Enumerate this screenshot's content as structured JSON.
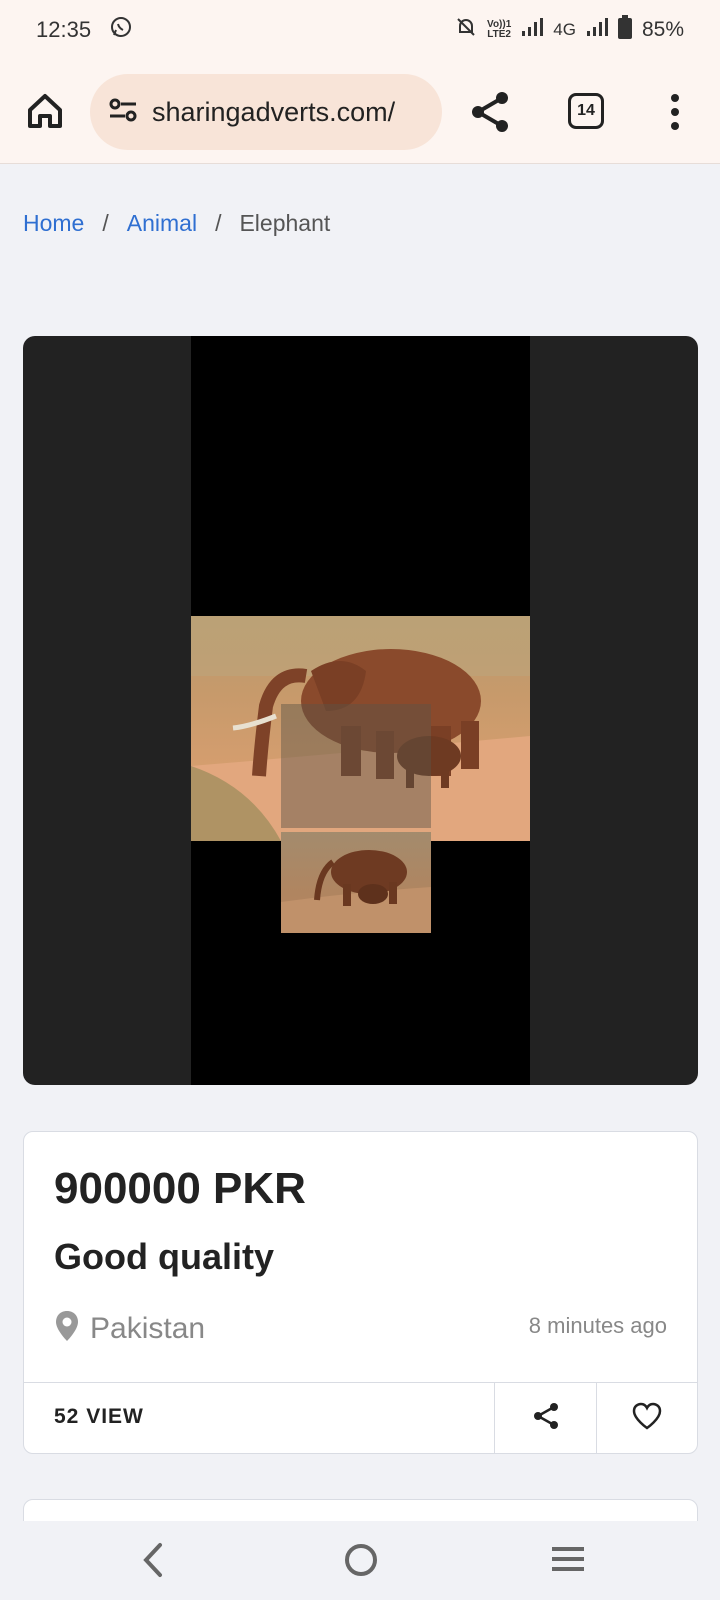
{
  "status_bar": {
    "time": "12:35",
    "volte_line1": "Vo))1",
    "volte_line2": "LTE2",
    "network": "4G",
    "battery": "85%"
  },
  "browser": {
    "url": "sharingadverts.com/",
    "tab_count": "14"
  },
  "breadcrumb": {
    "items": [
      "Home",
      "Animal",
      "Elephant"
    ],
    "separator": "/"
  },
  "listing": {
    "price": "900000 PKR",
    "title": "Good quality",
    "location": "Pakistan",
    "posted": "8 minutes ago",
    "views": "52 VIEW"
  },
  "colors": {
    "link": "#2f6fd1",
    "toolbar_bg": "#fdf5f1",
    "url_pill_bg": "#f8e4d8",
    "page_bg": "#f1f2f6"
  },
  "icons": [
    "whatsapp-icon",
    "mute-icon",
    "signal-icon",
    "battery-icon",
    "home-icon",
    "site-settings-icon",
    "share-icon",
    "tabs-icon",
    "more-icon",
    "location-pin-icon",
    "heart-icon",
    "nav-back-icon",
    "nav-home-icon",
    "nav-recent-icon"
  ]
}
